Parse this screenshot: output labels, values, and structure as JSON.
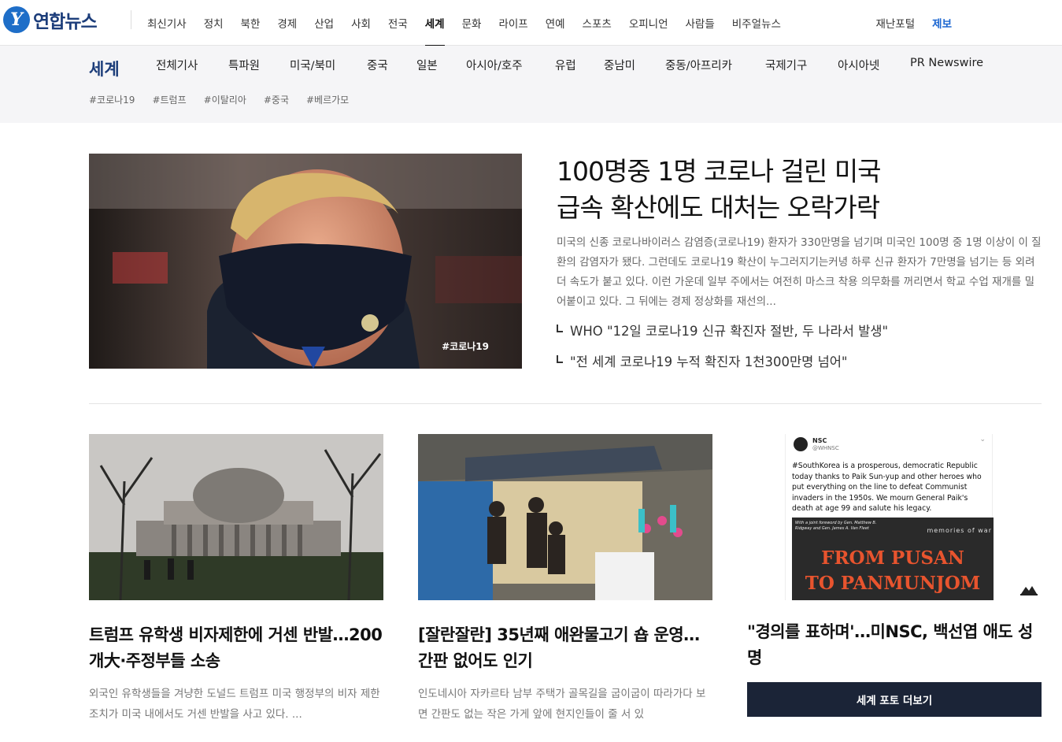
{
  "logo": {
    "mark": "Y",
    "text": "연합뉴스"
  },
  "gnb": [
    {
      "label": "최신기사",
      "active": false
    },
    {
      "label": "정치",
      "active": false
    },
    {
      "label": "북한",
      "active": false
    },
    {
      "label": "경제",
      "active": false
    },
    {
      "label": "산업",
      "active": false
    },
    {
      "label": "사회",
      "active": false
    },
    {
      "label": "전국",
      "active": false
    },
    {
      "label": "세계",
      "active": true
    },
    {
      "label": "문화",
      "active": false
    },
    {
      "label": "라이프",
      "active": false
    },
    {
      "label": "연예",
      "active": false
    },
    {
      "label": "스포츠",
      "active": false
    },
    {
      "label": "오피니언",
      "active": false
    },
    {
      "label": "사람들",
      "active": false
    },
    {
      "label": "비주얼뉴스",
      "active": false
    }
  ],
  "util": {
    "disaster": "재난포털",
    "tip": "제보"
  },
  "section": {
    "title": "세계",
    "submenu": [
      "전체기사",
      "특파원",
      "미국/북미",
      "중국",
      "일본",
      "아시아/호주",
      "유럽",
      "중남미",
      "중동/아프리카",
      "국제기구",
      "아시아넷",
      "PR Newswire"
    ],
    "tags": [
      "#코로나19",
      "#트럼프",
      "#이탈리아",
      "#중국",
      "#베르가모"
    ]
  },
  "hero": {
    "image_tag": "#코로나19",
    "title": "100명중 1명 코로나 걸린 미국\n급속 확산에도 대처는 오락가락",
    "summary": "미국의 신종 코로나바이러스 감염증(코로나19) 환자가 330만명을 넘기며 미국인 100명 중 1명 이상이 이 질환의 감염자가 됐다. 그런데도 코로나19 확산이 누그러지기는커녕 하루 신규 환자가 7만명을 넘기는 등 외려 더 속도가 붙고 있다. 이런 가운데 일부 주에서는 여전히 마스크 착용 의무화를 꺼리면서 학교 수업 재개를 밀어붙이고 있다. 그 뒤에는 경제 정상화를 재선의...",
    "related": [
      "WHO \"12일 코로나19 신규 확진자 절반, 두 나라서 발생\"",
      "\"전 세계 코로나19 누적 확진자 1천300만명 넘어\""
    ]
  },
  "cards": [
    {
      "title": "트럼프 유학생 비자제한에 거센 반발…200개大·주정부들 소송",
      "summary": "외국인 유학생들을 겨냥한 도널드 트럼프 미국 행정부의 비자 제한 조치가 미국 내에서도 거센 반발을 사고 있다. ..."
    },
    {
      "title": "[잘란잘란] 35년째 애완물고기 숍 운영…간판 없어도 인기",
      "summary": "인도네시아 자카르타 남부 주택가 골목길을 굽이굽이 따라가다 보면 간판도 없는 작은 가게 앞에 현지인들이 줄 서 있"
    },
    {
      "title": "\"경의를 표하며'…미NSC, 백선엽 애도 성명",
      "tweet": {
        "account": "NSC",
        "handle": "@WHNSC",
        "text": "#SouthKorea is a prosperous, democratic Republic today thanks to Paik Sun-yup and other heroes who put everything on the line to defeat Communist invaders in the 1950s.  We mourn General Paik's death at age 99 and salute his legacy.",
        "book_foreword": "With a joint foreword by Gen. Matthew B. Ridgway and Gen. James A. Van Fleet",
        "book_series": "memories of war",
        "book_title_1": "FROM PUSAN",
        "book_title_2": "TO PANMUNJOM"
      },
      "more_label": "세계 포토 더보기"
    }
  ],
  "colors": {
    "brand": "#1c3d7a",
    "accent": "#1d67d1",
    "dark_button": "#1b2437"
  }
}
